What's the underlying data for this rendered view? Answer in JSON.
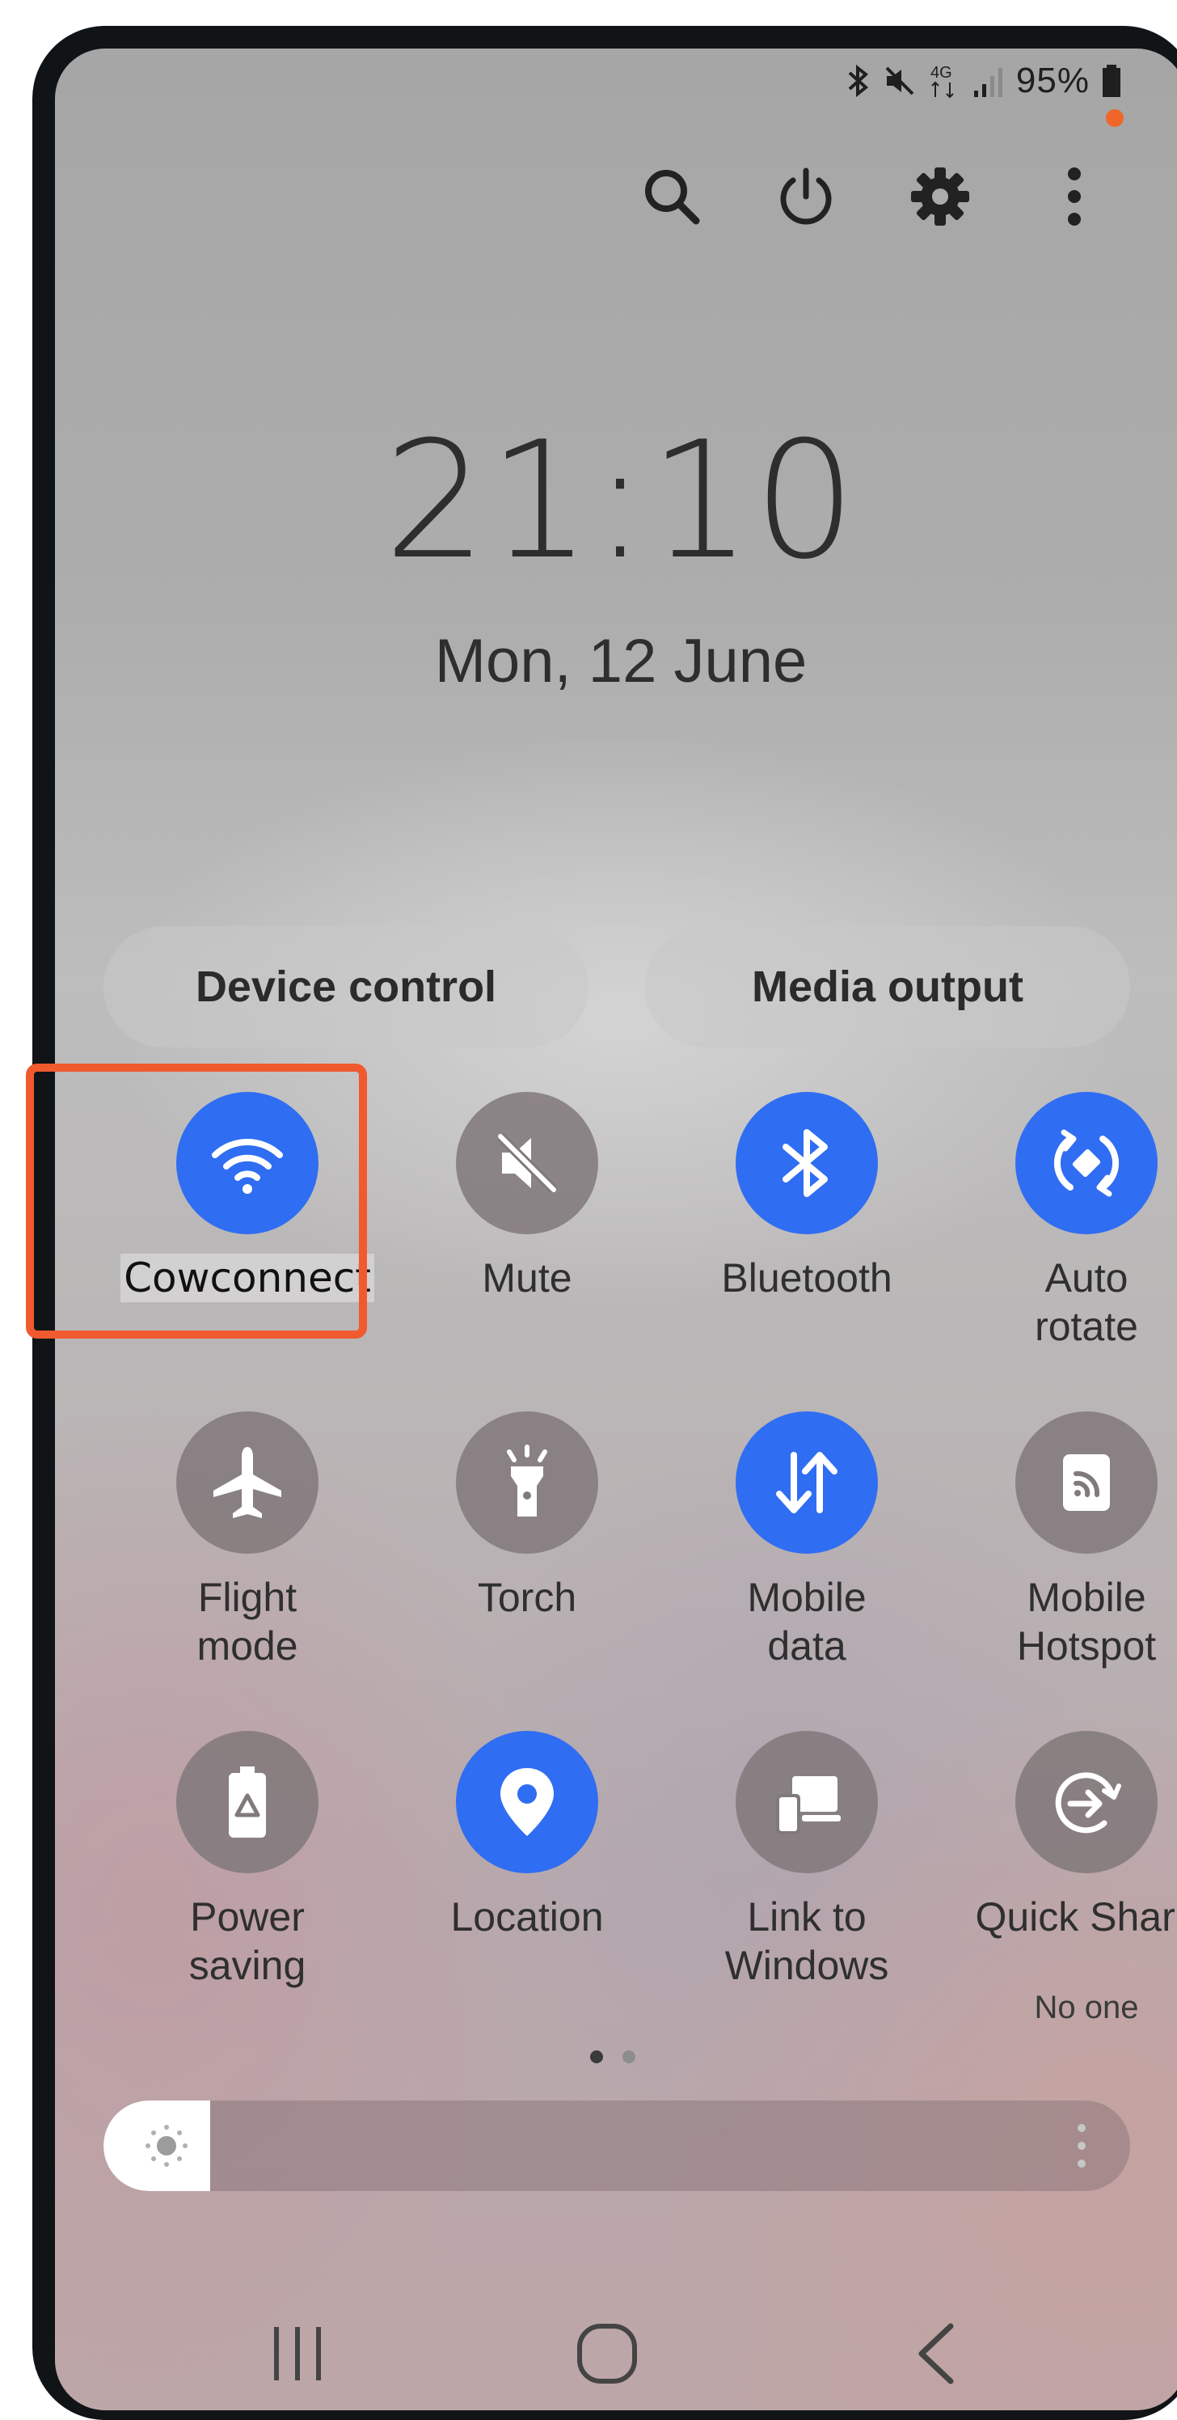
{
  "status_bar": {
    "network": "4G",
    "battery": "95%",
    "icons": [
      "bluetooth-icon",
      "mute-icon",
      "4g-icon",
      "signal-icon",
      "battery-icon"
    ]
  },
  "top_actions": [
    "search-icon",
    "power-icon",
    "gear-icon",
    "more-vert-icon"
  ],
  "clock": {
    "time": "21:10",
    "date": "Mon, 12 June"
  },
  "pills": {
    "device_control": "Device control",
    "media_output": "Media output"
  },
  "tiles": [
    {
      "label": "Cowconnect",
      "icon": "wifi-icon",
      "active": true
    },
    {
      "label": "Mute",
      "icon": "mute-icon",
      "active": false
    },
    {
      "label": "Bluetooth",
      "icon": "bluetooth-icon",
      "active": true
    },
    {
      "label": "Auto\nrotate",
      "icon": "auto-rotate-icon",
      "active": true
    },
    {
      "label": "Flight\nmode",
      "icon": "airplane-icon",
      "active": false
    },
    {
      "label": "Torch",
      "icon": "flashlight-icon",
      "active": false
    },
    {
      "label": "Mobile\ndata",
      "icon": "mobile-data-icon",
      "active": true
    },
    {
      "label": "Mobile\nHotspot",
      "icon": "hotspot-icon",
      "active": false
    },
    {
      "label": "Power\nsaving",
      "icon": "battery-saver-icon",
      "active": false
    },
    {
      "label": "Location",
      "icon": "location-pin-icon",
      "active": true
    },
    {
      "label": "Link to\nWindows",
      "icon": "link-to-windows-icon",
      "active": false
    },
    {
      "label": "Quick Share",
      "sublabel": "No one",
      "icon": "quick-share-icon",
      "active": false
    }
  ],
  "pagination": {
    "pages": 2,
    "current": 1
  },
  "brightness": {
    "level": 0.06
  },
  "colors": {
    "accent": "#2f6df2",
    "highlight": "#f05a2e",
    "inactive": "#807a7a"
  },
  "nav": [
    "recents-icon",
    "home-icon",
    "back-icon"
  ]
}
